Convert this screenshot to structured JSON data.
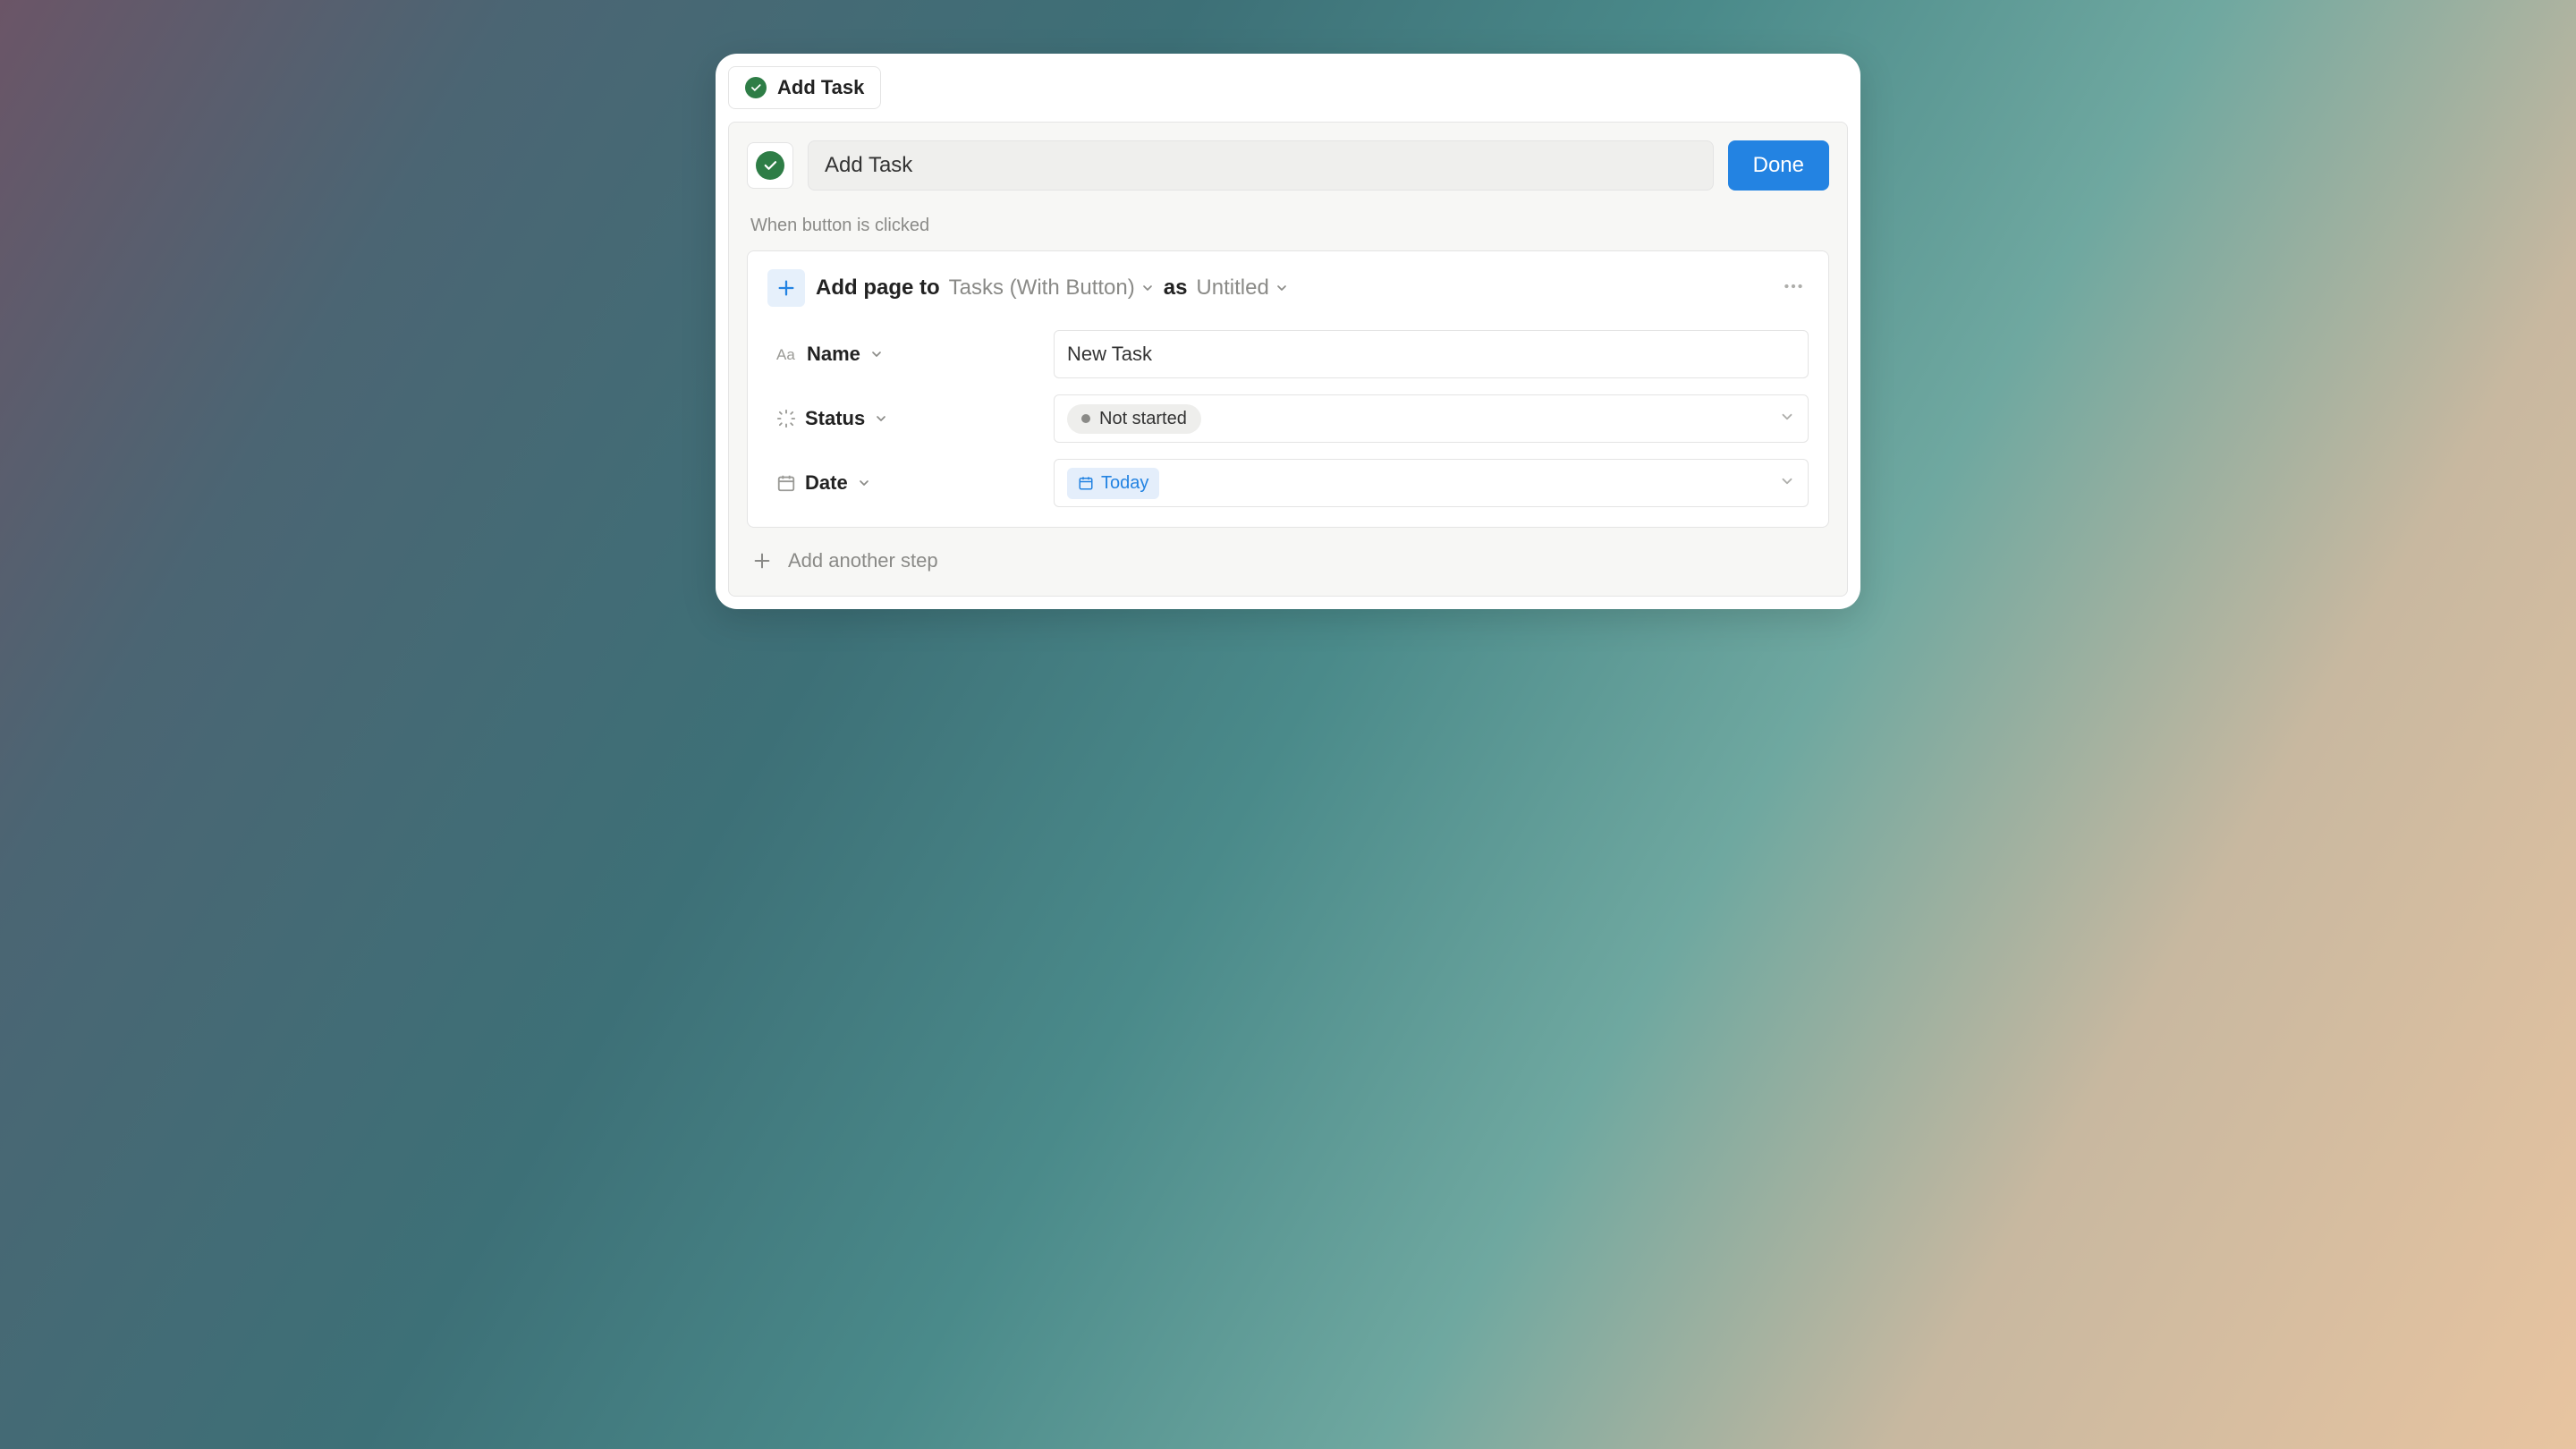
{
  "tab": {
    "label": "Add Task"
  },
  "editor": {
    "name_value": "Add Task",
    "done_label": "Done",
    "section_label": "When button is clicked"
  },
  "step": {
    "action_prefix": "Add page to",
    "target": "Tasks (With Button)",
    "as_label": "as",
    "page_title": "Untitled",
    "properties": {
      "name": {
        "label": "Name",
        "value": "New Task"
      },
      "status": {
        "label": "Status",
        "value": "Not started"
      },
      "date": {
        "label": "Date",
        "value": "Today"
      }
    }
  },
  "footer": {
    "add_step_label": "Add another step"
  },
  "colors": {
    "accent": "#2383e2",
    "check": "#2e7d46"
  }
}
